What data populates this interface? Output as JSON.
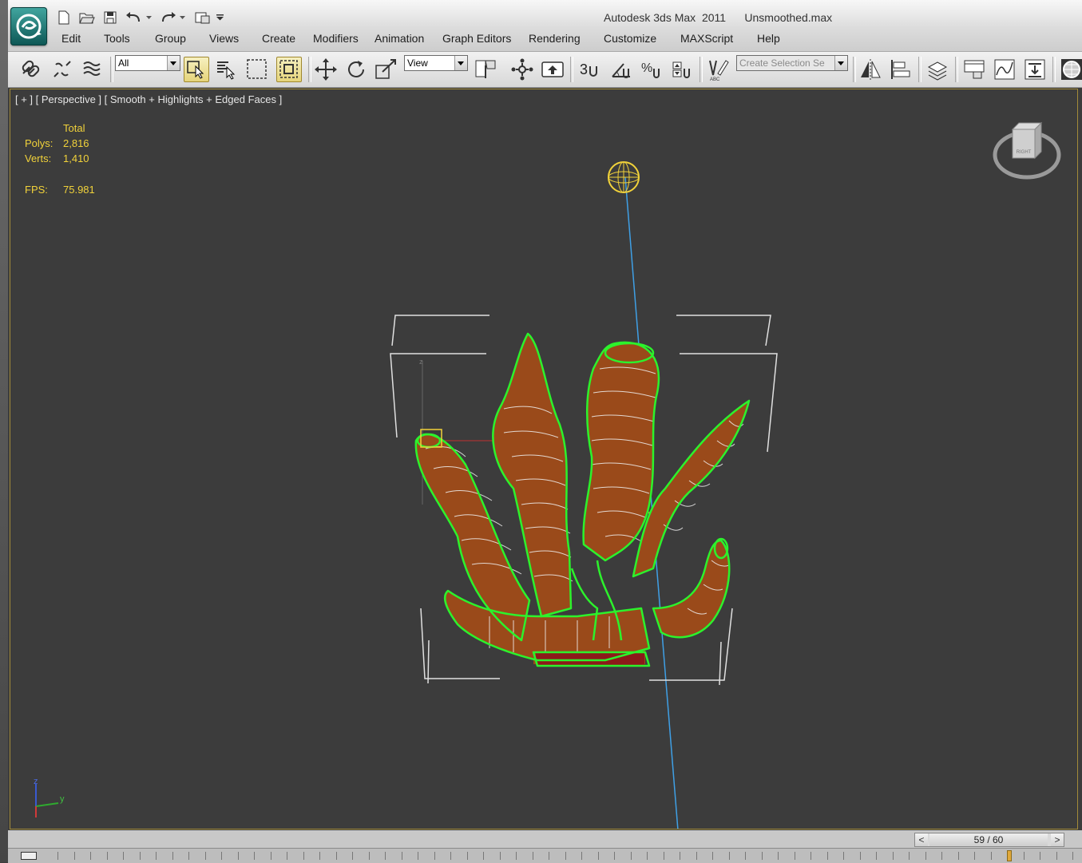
{
  "window": {
    "title": "Autodesk 3ds Max  2011",
    "filename": "Unsmoothed.max"
  },
  "menu": [
    "Edit",
    "Tools",
    "Group",
    "Views",
    "Create",
    "Modifiers",
    "Animation",
    "Graph Editors",
    "Rendering",
    "Customize",
    "MAXScript",
    "Help"
  ],
  "toolbar": {
    "selection_filter": "All",
    "reference_coord": "View",
    "named_selection_placeholder": "Create Selection Se",
    "snap_label": "3"
  },
  "viewport": {
    "label": "[ + ] [ Perspective ] [ Smooth + Highlights + Edged Faces ]",
    "stats": {
      "header": "Total",
      "polys_label": "Polys:",
      "polys": "2,816",
      "verts_label": "Verts:",
      "verts": "1,410",
      "fps_label": "FPS:",
      "fps": "75.981"
    },
    "viewcube_face": "RIGHT",
    "axis": {
      "z": "z",
      "y": "y"
    },
    "gizmo_axis": "z"
  },
  "timeline": {
    "frame": "59 / 60",
    "prev": "<",
    "next": ">"
  },
  "colors": {
    "selection_wire": "#2cf22c",
    "object_fill": "#9a4a1a",
    "light": "#f1d23a",
    "target_line": "#3fa0e6",
    "viewport_bg": "#3c3c3c",
    "active_border": "#a38b3a"
  }
}
